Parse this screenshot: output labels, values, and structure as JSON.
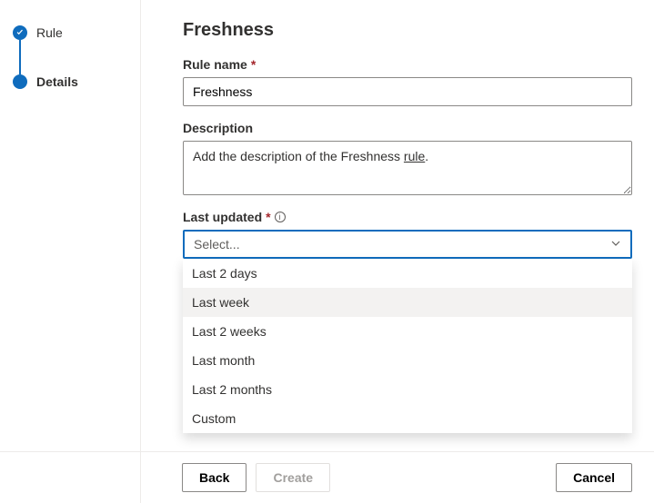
{
  "sidebar": {
    "steps": [
      {
        "label": "Rule",
        "state": "completed"
      },
      {
        "label": "Details",
        "state": "current"
      }
    ]
  },
  "page": {
    "title": "Freshness"
  },
  "fields": {
    "rule_name": {
      "label": "Rule name",
      "value": "Freshness"
    },
    "description": {
      "label": "Description",
      "value_prefix": "Add the description of the Freshness ",
      "value_underlined": "rule",
      "value_suffix": "."
    },
    "last_updated": {
      "label": "Last updated",
      "placeholder": "Select...",
      "options": [
        "Last 2 days",
        "Last week",
        "Last 2 weeks",
        "Last month",
        "Last 2 months",
        "Custom"
      ],
      "hovered_index": 1
    }
  },
  "footer": {
    "back": "Back",
    "create": "Create",
    "cancel": "Cancel"
  }
}
